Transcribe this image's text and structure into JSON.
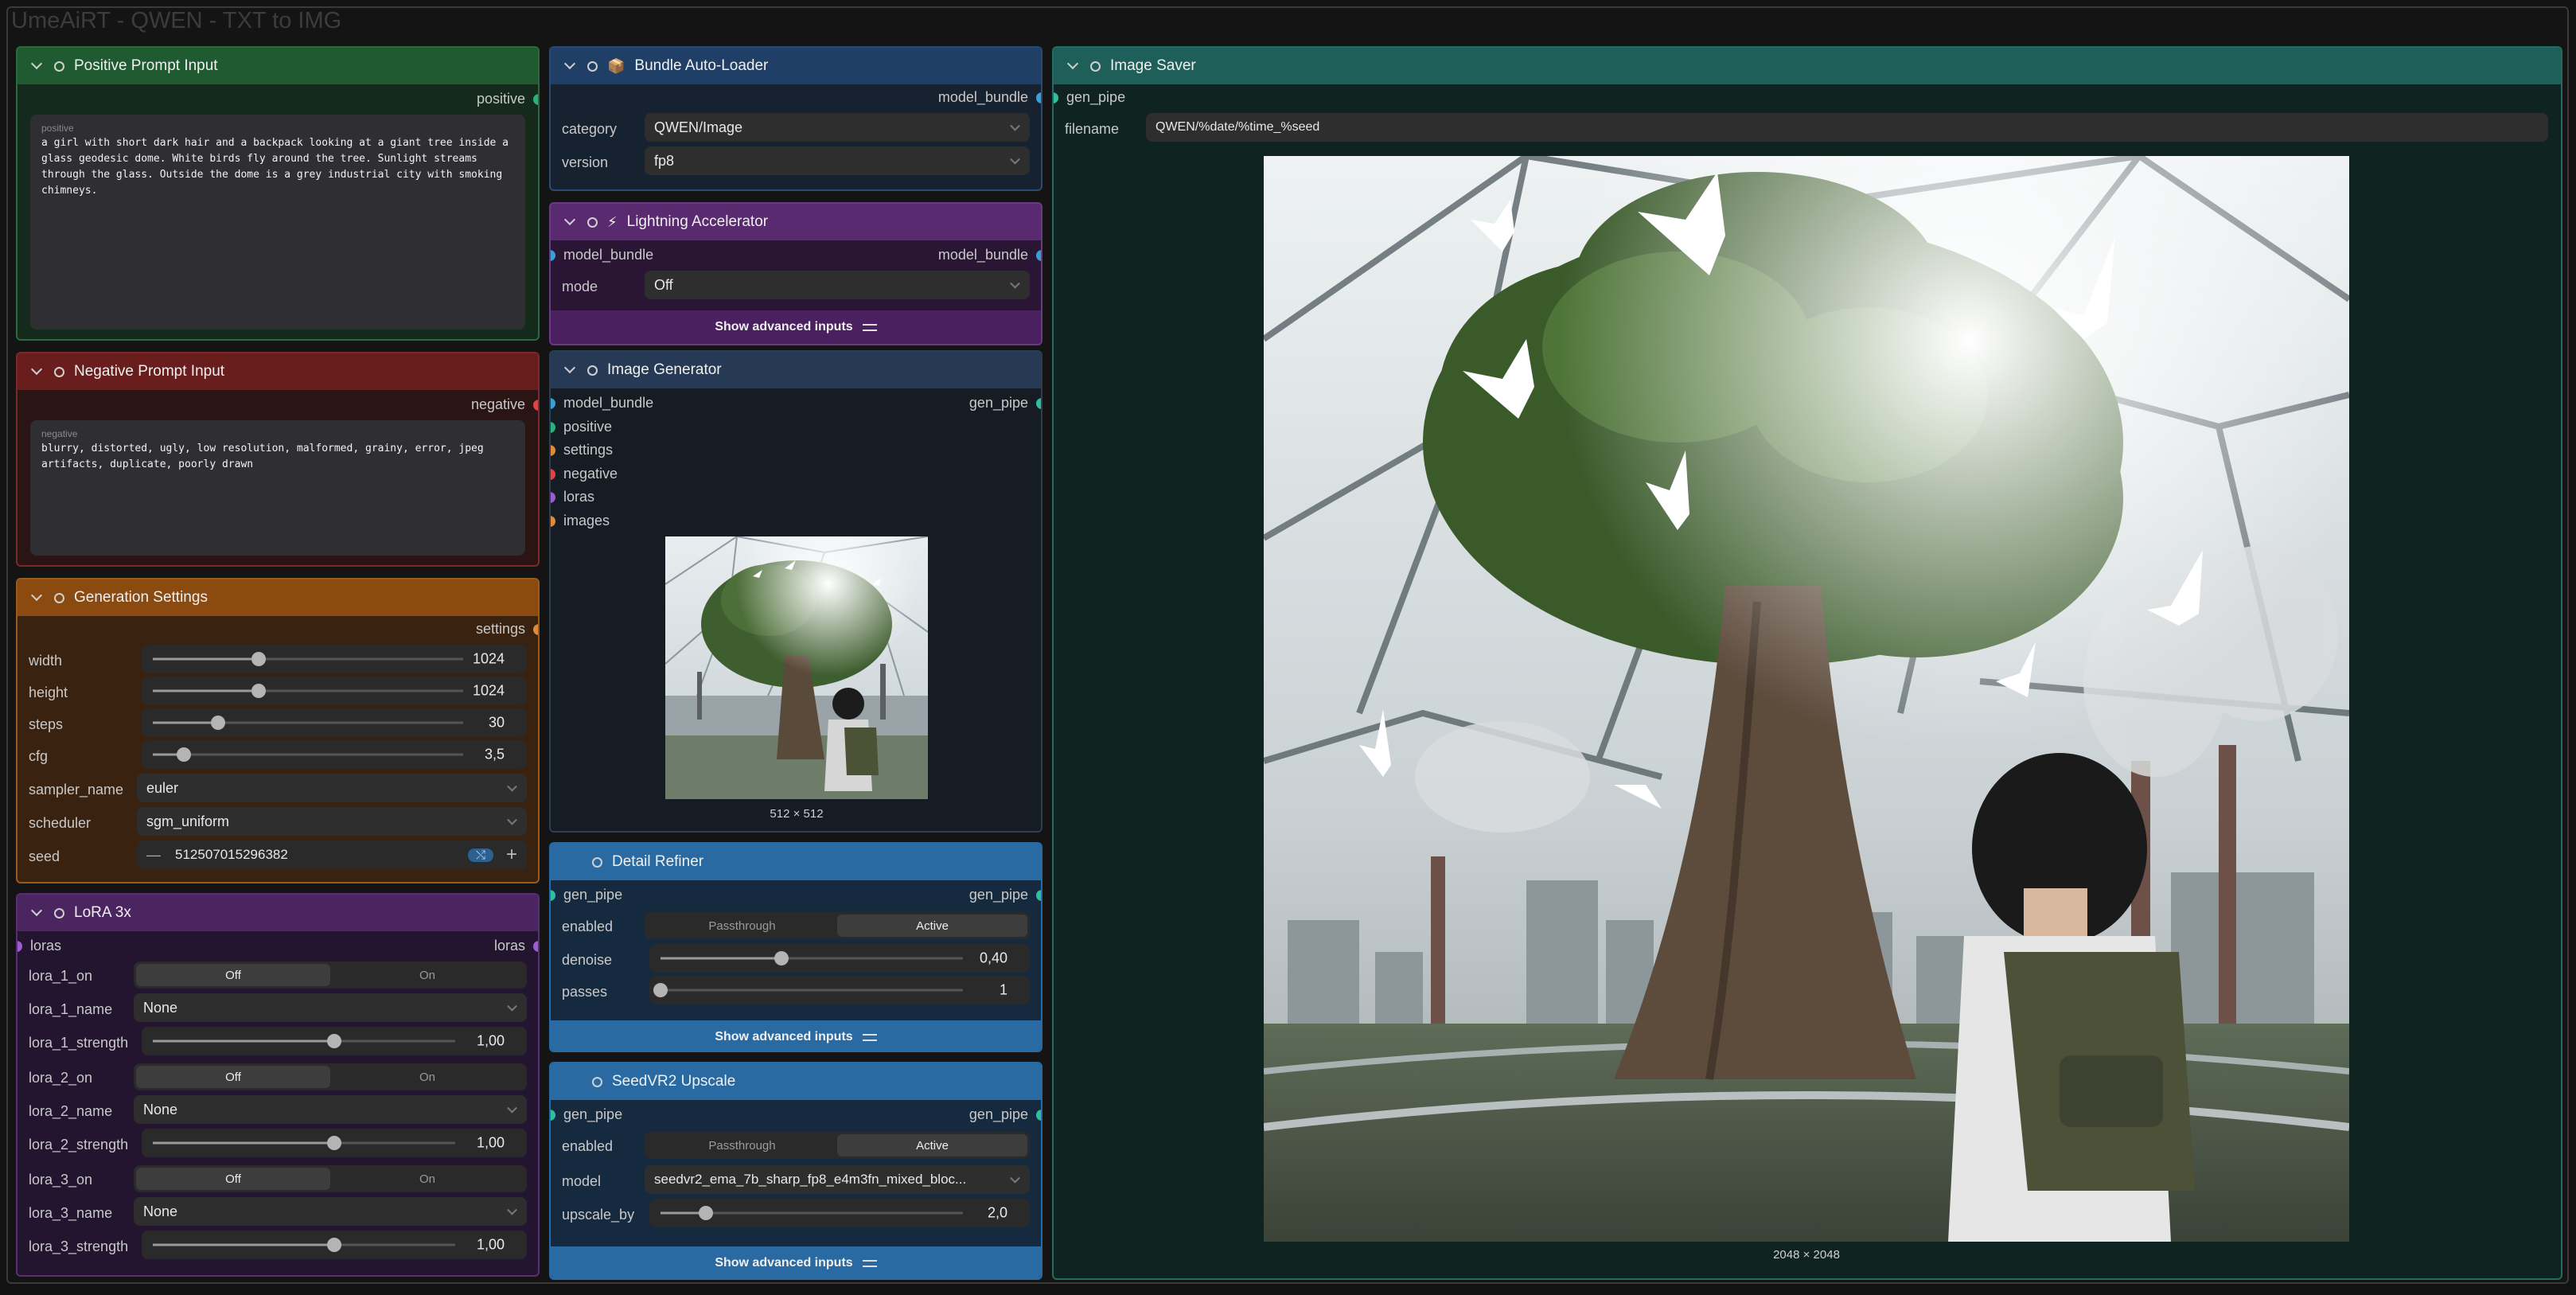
{
  "app": {
    "group_title": "UmeAiRT - QWEN - TXT to IMG"
  },
  "colors": {
    "positive": "#1f5a30",
    "negative": "#6a1d1d",
    "settings": "#8a4a10",
    "lora": "#4a2560",
    "bundle": "#1f3f66",
    "lightning": "#5a2a70",
    "generator": "#263a55",
    "refiner": "#2a6aa3",
    "saver": "#1f5f5a"
  },
  "positive_node": {
    "title": "Positive Prompt Input",
    "output_label": "positive",
    "text_label": "positive",
    "text": "a girl with short dark hair and a backpack looking at a giant tree inside a glass geodesic dome. White birds fly around the tree. Sunlight streams through the glass. Outside the dome is a grey industrial city with smoking chimneys."
  },
  "negative_node": {
    "title": "Negative Prompt Input",
    "output_label": "negative",
    "text_label": "negative",
    "text": "blurry, distorted, ugly, low resolution, malformed, grainy, error, jpeg artifacts, duplicate, poorly drawn"
  },
  "settings_node": {
    "title": "Generation Settings",
    "output_label": "settings",
    "width_label": "width",
    "width_value": "1024",
    "width_frac": 0.34,
    "height_label": "height",
    "height_value": "1024",
    "height_frac": 0.34,
    "steps_label": "steps",
    "steps_value": "30",
    "steps_frac": 0.21,
    "cfg_label": "cfg",
    "cfg_value": "3,5",
    "cfg_frac": 0.1,
    "sampler_label": "sampler_name",
    "sampler_value": "euler",
    "scheduler_label": "scheduler",
    "scheduler_value": "sgm_uniform",
    "seed_label": "seed",
    "seed_value": "512507015296382",
    "seed_minus": "—",
    "seed_plus": "+",
    "seed_badge": "⤭"
  },
  "lora_node": {
    "title": "LoRA 3x",
    "input_label": "loras",
    "output_label": "loras",
    "off": "Off",
    "on": "On",
    "none": "None",
    "l1_on": "lora_1_on",
    "l1_name": "lora_1_name",
    "l1_strength": "lora_1_strength",
    "l1_value": "1,00",
    "l2_on": "lora_2_on",
    "l2_name": "lora_2_name",
    "l2_strength": "lora_2_strength",
    "l2_value": "1,00",
    "l3_on": "lora_3_on",
    "l3_name": "lora_3_name",
    "l3_strength": "lora_3_strength",
    "l3_value": "1,00",
    "strength_frac": 0.6
  },
  "bundle_node": {
    "icon": "📦",
    "title": "Bundle Auto-Loader",
    "output_label": "model_bundle",
    "category_label": "category",
    "category_value": "QWEN/Image",
    "version_label": "version",
    "version_value": "fp8"
  },
  "lightning_node": {
    "icon": "⚡",
    "title": "Lightning Accelerator",
    "input_label": "model_bundle",
    "output_label": "model_bundle",
    "mode_label": "mode",
    "mode_value": "Off",
    "advanced": "Show advanced inputs"
  },
  "generator_node": {
    "title": "Image Generator",
    "inputs": [
      "model_bundle",
      "positive",
      "settings",
      "negative",
      "loras",
      "images"
    ],
    "output_label": "gen_pipe",
    "preview_size": "512 × 512"
  },
  "refiner_node": {
    "title": "Detail Refiner",
    "input_label": "gen_pipe",
    "output_label": "gen_pipe",
    "enabled_label": "enabled",
    "passthrough": "Passthrough",
    "active": "Active",
    "denoise_label": "denoise",
    "denoise_value": "0,40",
    "denoise_frac": 0.4,
    "passes_label": "passes",
    "passes_value": "1",
    "passes_frac": 0.0,
    "advanced": "Show advanced inputs"
  },
  "upscale_node": {
    "title": "SeedVR2 Upscale",
    "input_label": "gen_pipe",
    "output_label": "gen_pipe",
    "enabled_label": "enabled",
    "passthrough": "Passthrough",
    "active": "Active",
    "model_label": "model",
    "model_value": "seedvr2_ema_7b_sharp_fp8_e4m3fn_mixed_bloc...",
    "upscale_label": "upscale_by",
    "upscale_value": "2,0",
    "upscale_frac": 0.15,
    "advanced": "Show advanced inputs"
  },
  "saver_node": {
    "title": "Image Saver",
    "input_label": "gen_pipe",
    "filename_label": "filename",
    "filename_value": "QWEN/%date/%time_%seed",
    "image_size": "2048 × 2048"
  }
}
